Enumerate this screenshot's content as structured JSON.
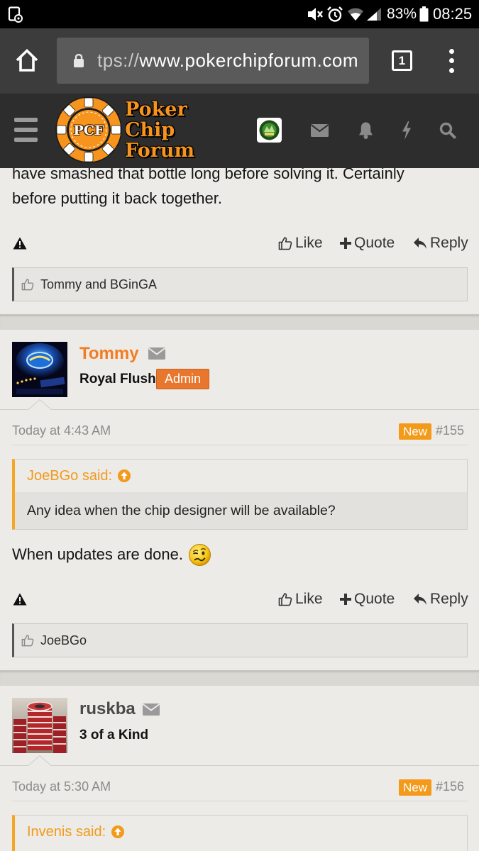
{
  "status_bar": {
    "battery": "83%",
    "time": "08:25",
    "icons": [
      "screenshot-icon",
      "mute-icon",
      "alarm-icon",
      "wifi-icon",
      "signal-icon",
      "battery-icon"
    ]
  },
  "browser": {
    "url_scheme": "tps://",
    "url_host": "www.pokerchipforum.com",
    "tab_count": "1",
    "icons": [
      "home-icon",
      "lock-icon",
      "tab-switcher-icon",
      "more-menu-icon"
    ]
  },
  "site_header": {
    "logo_badge": "PCF",
    "logo_words": [
      "Poker",
      "Chip",
      "Forum"
    ],
    "icons": [
      "hamburger-menu-icon",
      "header-avatar",
      "envelope-icon",
      "bell-icon",
      "lightning-icon",
      "search-icon"
    ]
  },
  "colors": {
    "brand_orange": "#f7941d",
    "username_orange": "#f47c20",
    "quote_orange": "#f29a1b",
    "new_badge": "#f39a1a",
    "admin_badge": "#e8762d",
    "page_background": "#ecebe7",
    "header_background": "#2d2d2d"
  },
  "posts": [
    {
      "body_lines": [
        "have smashed that bottle long before solving it. Certainly",
        "before putting it back together."
      ],
      "actions": {
        "like": "Like",
        "quote": "Quote",
        "reply": "Reply"
      },
      "likes": "Tommy and BGinGA"
    },
    {
      "author": "Tommy",
      "user_title": "Royal Flush",
      "badge": "Admin",
      "date": "Today at 4:43 AM",
      "new_label": "New",
      "post_number": "#155",
      "quote": {
        "author": "JoeBGo said:",
        "text": "Any idea when the chip designer will be available?"
      },
      "body": "When updates are done.",
      "actions": {
        "like": "Like",
        "quote": "Quote",
        "reply": "Reply"
      },
      "likes": "JoeBGo"
    },
    {
      "author": "ruskba",
      "user_title": "3 of a Kind",
      "date": "Today at 5:30 AM",
      "new_label": "New",
      "post_number": "#156",
      "quote": {
        "author": "Invenis said:"
      }
    }
  ]
}
